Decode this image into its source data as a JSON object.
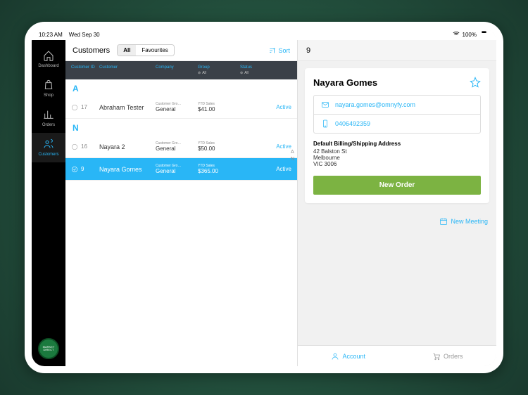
{
  "statusbar": {
    "time": "10:23 AM",
    "date": "Wed Sep 30",
    "battery": "100%"
  },
  "sidebar": {
    "items": [
      {
        "label": "Dashboard"
      },
      {
        "label": "Shop"
      },
      {
        "label": "Orders"
      },
      {
        "label": "Customers"
      }
    ],
    "logo": "MARKET DIRECT"
  },
  "mid": {
    "title": "Customers",
    "seg_all": "All",
    "seg_fav": "Favourites",
    "sort": "Sort",
    "headers": {
      "id": "Customer ID",
      "name": "Customer",
      "company": "Company",
      "group": "Group",
      "status": "Status",
      "all": "All"
    },
    "sections": [
      {
        "letter": "A",
        "rows": [
          {
            "id": "17",
            "name": "Abraham Tester",
            "group_label": "Customer Gro…",
            "group": "General",
            "sales_label": "YTD Sales",
            "sales": "$41.00",
            "status": "Active",
            "selected": false
          }
        ]
      },
      {
        "letter": "N",
        "rows": [
          {
            "id": "16",
            "name": "Nayara 2",
            "group_label": "Customer Gro…",
            "group": "General",
            "sales_label": "YTD Sales",
            "sales": "$50.00",
            "status": "Active",
            "selected": false
          },
          {
            "id": "9",
            "name": "Nayara Gomes",
            "group_label": "Customer Gro…",
            "group": "General",
            "sales_label": "YTD Sales",
            "sales": "$365.00",
            "status": "Active",
            "selected": true
          }
        ]
      }
    ],
    "index": [
      "A",
      "N"
    ]
  },
  "detail": {
    "top_id": "9",
    "name": "Nayara Gomes",
    "email": "nayara.gomes@omnyfy.com",
    "phone": "0406492359",
    "addr_label": "Default Billing/Shipping Address",
    "addr1": "42 Balston St",
    "addr2": "Melbourne",
    "addr3": "VIC 3006",
    "new_order": "New Order",
    "new_meeting": "New Meeting",
    "footer_account": "Account",
    "footer_orders": "Orders"
  }
}
